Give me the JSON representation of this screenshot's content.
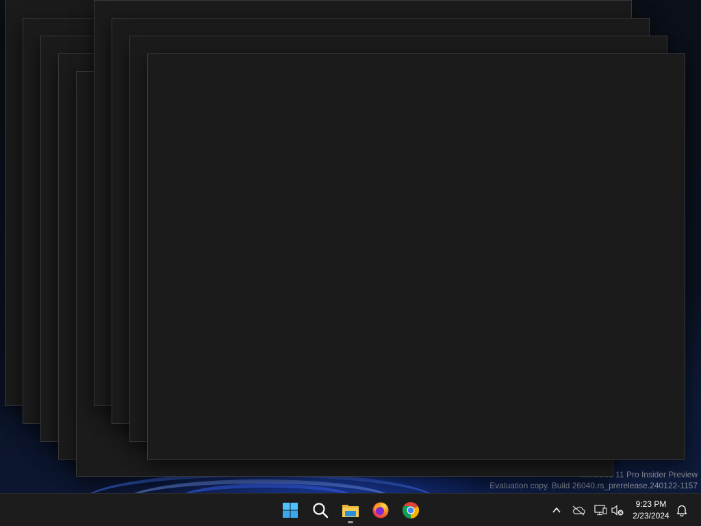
{
  "desktop": {
    "watermark_line1": "Windows 11 Pro Insider Preview",
    "watermark_line2": "Evaluation copy. Build 26040.rs_prerelease.240122-1157"
  },
  "taskbar": {
    "pinned": [
      {
        "name": "start-button",
        "icon": "windows-logo-icon",
        "running": false
      },
      {
        "name": "search-button",
        "icon": "search-icon",
        "running": false
      },
      {
        "name": "file-explorer-button",
        "icon": "folder-icon",
        "running": true
      },
      {
        "name": "firefox-button",
        "icon": "firefox-icon",
        "running": false
      },
      {
        "name": "chrome-button",
        "icon": "chrome-icon",
        "running": false
      }
    ],
    "tray": {
      "icons": [
        "chevron-up-icon",
        "onedrive-offline-icon",
        "network-icon",
        "volume-muted-icon"
      ],
      "time": "9:23 PM",
      "date": "2/23/2024",
      "notification_icon": "bell-icon"
    }
  },
  "colors": {
    "window_bg": "#1b1b1b",
    "taskbar_bg": "#1c1c1c",
    "accent": "#4cc2ff"
  }
}
